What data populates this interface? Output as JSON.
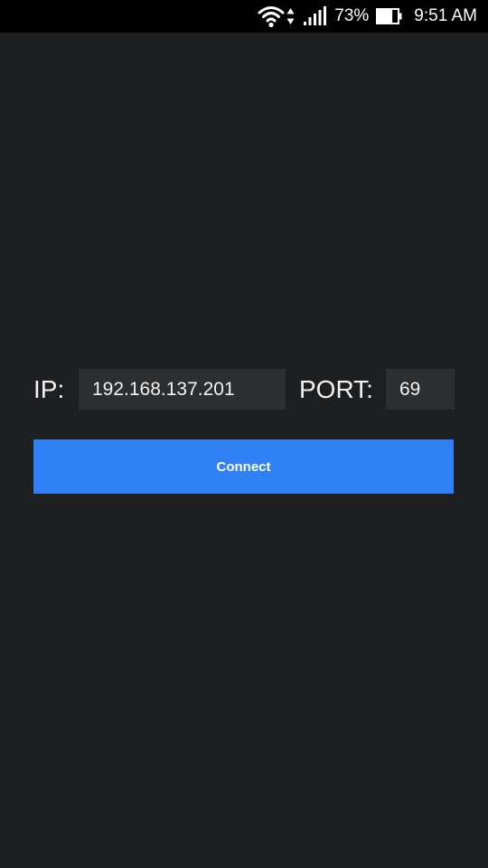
{
  "status_bar": {
    "battery_percent": "73%",
    "time": "9:51 AM",
    "battery_level": 0.73,
    "icons": [
      "wifi-icon",
      "data-arrows-icon",
      "signal-icon",
      "battery-icon"
    ]
  },
  "form": {
    "ip_label": "IP:",
    "ip_value": "192.168.137.201",
    "port_label": "PORT:",
    "port_value": "69",
    "connect_label": "Connect"
  },
  "colors": {
    "background": "#1e1f21",
    "status_bar": "#000000",
    "field_background": "#2d2e30",
    "accent": "#2f80f5",
    "text": "#ffffff"
  }
}
